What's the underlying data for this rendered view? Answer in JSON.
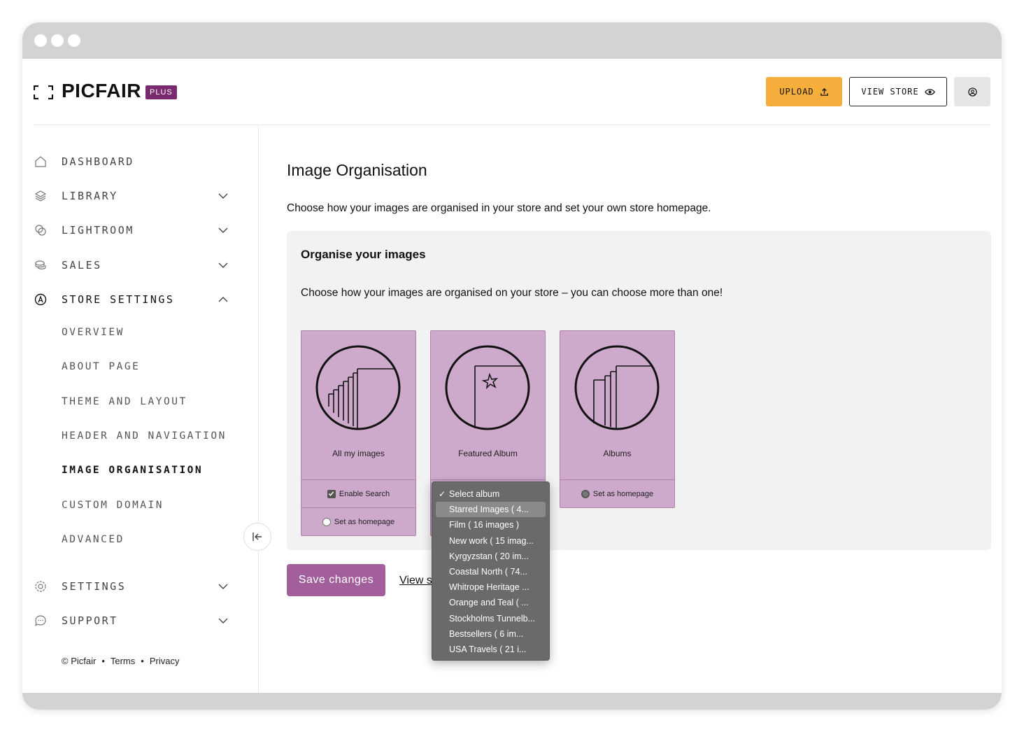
{
  "app": {
    "logo": "PICFAIR",
    "badge": "PLUS"
  },
  "header": {
    "upload_label": "UPLOAD",
    "view_store_label": "VIEW STORE"
  },
  "sidebar": {
    "items": [
      {
        "label": "DASHBOARD",
        "icon": "home-icon"
      },
      {
        "label": "LIBRARY",
        "icon": "layers-icon"
      },
      {
        "label": "LIGHTROOM",
        "icon": "lightroom-icon"
      },
      {
        "label": "SALES",
        "icon": "coins-icon"
      },
      {
        "label": "STORE SETTINGS",
        "icon": "store-icon"
      },
      {
        "label": "SETTINGS",
        "icon": "gear-icon"
      },
      {
        "label": "SUPPORT",
        "icon": "chat-icon"
      }
    ],
    "store_sub": [
      "OVERVIEW",
      "ABOUT PAGE",
      "THEME AND LAYOUT",
      "HEADER AND NAVIGATION",
      "IMAGE ORGANISATION",
      "CUSTOM DOMAIN",
      "ADVANCED"
    ],
    "footer": {
      "copyright": "© Picfair",
      "terms": "Terms",
      "privacy": "Privacy"
    }
  },
  "main": {
    "title": "Image Organisation",
    "description": "Choose how your images are organised in your store and set your own store homepage.",
    "panel": {
      "title": "Organise your images",
      "description": "Choose how your images are organised on your store – you can choose more than one!",
      "cards": [
        {
          "name": "All my images",
          "option1": "Enable Search",
          "option2": "Set as homepage"
        },
        {
          "name": "Featured Album"
        },
        {
          "name": "Albums",
          "option1": "Set as homepage"
        }
      ]
    },
    "save_label": "Save changes",
    "view_link": "View s"
  },
  "dropdown": {
    "options": [
      "Select album",
      "Starred Images ( 4...",
      "Film ( 16 images )",
      "New work ( 15 imag...",
      "Kyrgyzstan ( 20 im...",
      "Coastal North ( 74...",
      "Whitrope Heritage ...",
      "Orange and Teal ( ...",
      "Stockholms Tunnelb...",
      "Bestsellers ( 6 im...",
      "USA Travels ( 21 i..."
    ],
    "checked_index": 0,
    "highlighted_index": 1
  },
  "colors": {
    "upload": "#f5ad3c",
    "badge": "#7a2a6e",
    "card": "#cdaacb",
    "save": "#a35e9c"
  }
}
